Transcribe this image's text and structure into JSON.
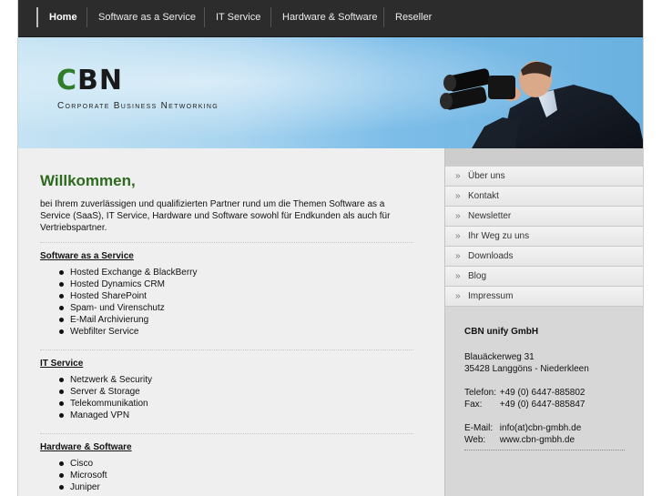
{
  "nav": {
    "items": [
      {
        "label": "Home",
        "active": true
      },
      {
        "label": "Software as a Service"
      },
      {
        "label": "IT Service"
      },
      {
        "label": "Hardware & Software"
      },
      {
        "label": "Reseller"
      }
    ]
  },
  "header": {
    "logo": "CBN",
    "tagline": "Corporate Business Networking"
  },
  "main": {
    "title": "Willkommen,",
    "intro": "bei Ihrem zuverlässigen und qualifizierten Partner rund um die Themen Software as a Service (SaaS), IT Service, Hardware und Software sowohl für Endkunden als auch für Vertriebspartner.",
    "sections": [
      {
        "title": "Software as a Service",
        "items": [
          "Hosted Exchange & BlackBerry",
          "Hosted Dynamics CRM",
          "Hosted SharePoint",
          "Spam- und Virenschutz",
          "E-Mail Archivierung",
          "Webfilter Service"
        ]
      },
      {
        "title": "IT Service",
        "items": [
          "Netzwerk & Security",
          "Server & Storage",
          "Telekommunikation",
          "Managed VPN"
        ]
      },
      {
        "title": "Hardware & Software",
        "items": [
          "Cisco",
          "Microsoft",
          "Juniper"
        ]
      }
    ]
  },
  "sidebar": {
    "menu": [
      "Über uns",
      "Kontakt",
      "Newsletter",
      "Ihr Weg zu uns",
      "Downloads",
      "Blog",
      "Impressum"
    ],
    "company": {
      "name": "CBN unify GmbH",
      "street": "Blauäckerweg 31",
      "city": "35428 Langgöns - Niederkleen",
      "phone_label": "Telefon:",
      "phone": "+49 (0) 6447-885802",
      "fax_label": "Fax:",
      "fax": "+49 (0) 6447-885847",
      "email_label": "E-Mail:",
      "email": "info(at)cbn-gmbh.de",
      "web_label": "Web:",
      "web": "www.cbn-gmbh.de"
    }
  },
  "colors": {
    "nav_bg": "#2c2c2c",
    "title_green": "#2d6a1e",
    "logo_c_green": "#2f7d2a"
  }
}
